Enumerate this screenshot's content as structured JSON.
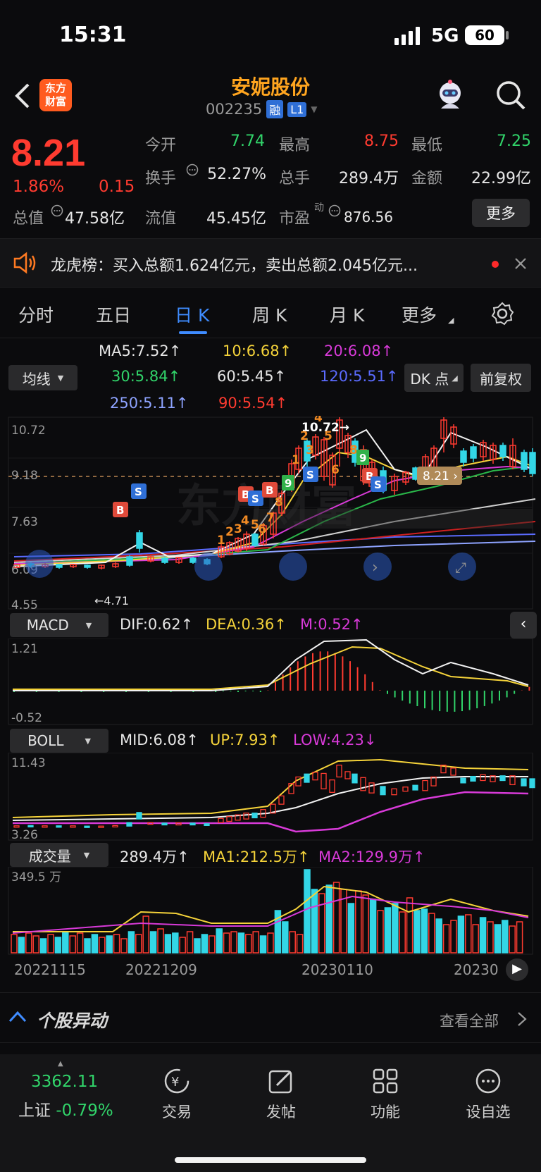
{
  "status": {
    "time": "15:31",
    "network": "5G",
    "battery": "60"
  },
  "header": {
    "logo_line1": "东方",
    "logo_line2": "财富",
    "stock_name": "安妮股份",
    "stock_code": "002235",
    "badge_rong": "融",
    "badge_l1": "L1"
  },
  "quote": {
    "price": "8.21",
    "change_pct": "1.86%",
    "change_amt": "0.15",
    "open_label": "今开",
    "open": "7.74",
    "high_label": "最高",
    "high": "8.75",
    "low_label": "最低",
    "low": "7.25",
    "turnover_label": "换手",
    "turnover": "52.27%",
    "volume_label": "总手",
    "volume": "289.4万",
    "amount_label": "金额",
    "amount": "22.99亿",
    "mcap_label": "总值",
    "mcap": "47.58亿",
    "float_label": "流值",
    "float_cap": "45.45亿",
    "pe_label": "市盈",
    "pe_sup": "动",
    "pe": "876.56",
    "more_label": "更多"
  },
  "news": {
    "text": "龙虎榜：买入总额1.624亿元，卖出总额2.045亿元..."
  },
  "tabs": [
    {
      "label": "分时"
    },
    {
      "label": "五日"
    },
    {
      "label": "日 K"
    },
    {
      "label": "周 K"
    },
    {
      "label": "月 K"
    },
    {
      "label": "更多"
    }
  ],
  "ma": {
    "selector": "均线",
    "ma5": "MA5:7.52",
    "ma10": "10:6.68",
    "ma20": "20:6.08",
    "ma30": "30:5.84",
    "ma60": "60:5.45",
    "ma120": "120:5.51",
    "ma250": "250:5.11",
    "ma90": "90:5.54",
    "dk_label": "DK 点",
    "adjust_label": "前复权"
  },
  "kchart": {
    "y_top": "10.72",
    "y_2": "9.18",
    "y_3": "7.63",
    "y_4": "6.09",
    "y_bottom": "4.55",
    "high_marker": "10.72",
    "low_marker": "4.71",
    "price_tag": "8.21",
    "watermark": "东方财富"
  },
  "macd": {
    "selector": "MACD",
    "dif": "DIF:0.62",
    "dea": "DEA:0.36",
    "m": "M:0.52",
    "y_top": "1.21",
    "y_bottom": "-0.52"
  },
  "boll": {
    "selector": "BOLL",
    "mid": "MID:6.08",
    "up": "UP:7.93",
    "low": "LOW:4.23",
    "y_top": "11.43",
    "y_bottom": "3.26"
  },
  "vol": {
    "selector": "成交量",
    "vol": "289.4万",
    "ma1": "MA1:212.5万",
    "ma2": "MA2:129.9万",
    "y_top": "349.5 万",
    "dates": [
      "20221115",
      "20221209",
      "20230110",
      "20230"
    ]
  },
  "movers": {
    "title": "个股异动",
    "view_all": "查看全部"
  },
  "bottom_nav": {
    "index_value": "3362.11",
    "index_name": "上证",
    "index_change": "-0.79%",
    "items": [
      {
        "label": "交易"
      },
      {
        "label": "发帖"
      },
      {
        "label": "功能"
      },
      {
        "label": "设自选"
      }
    ]
  }
}
